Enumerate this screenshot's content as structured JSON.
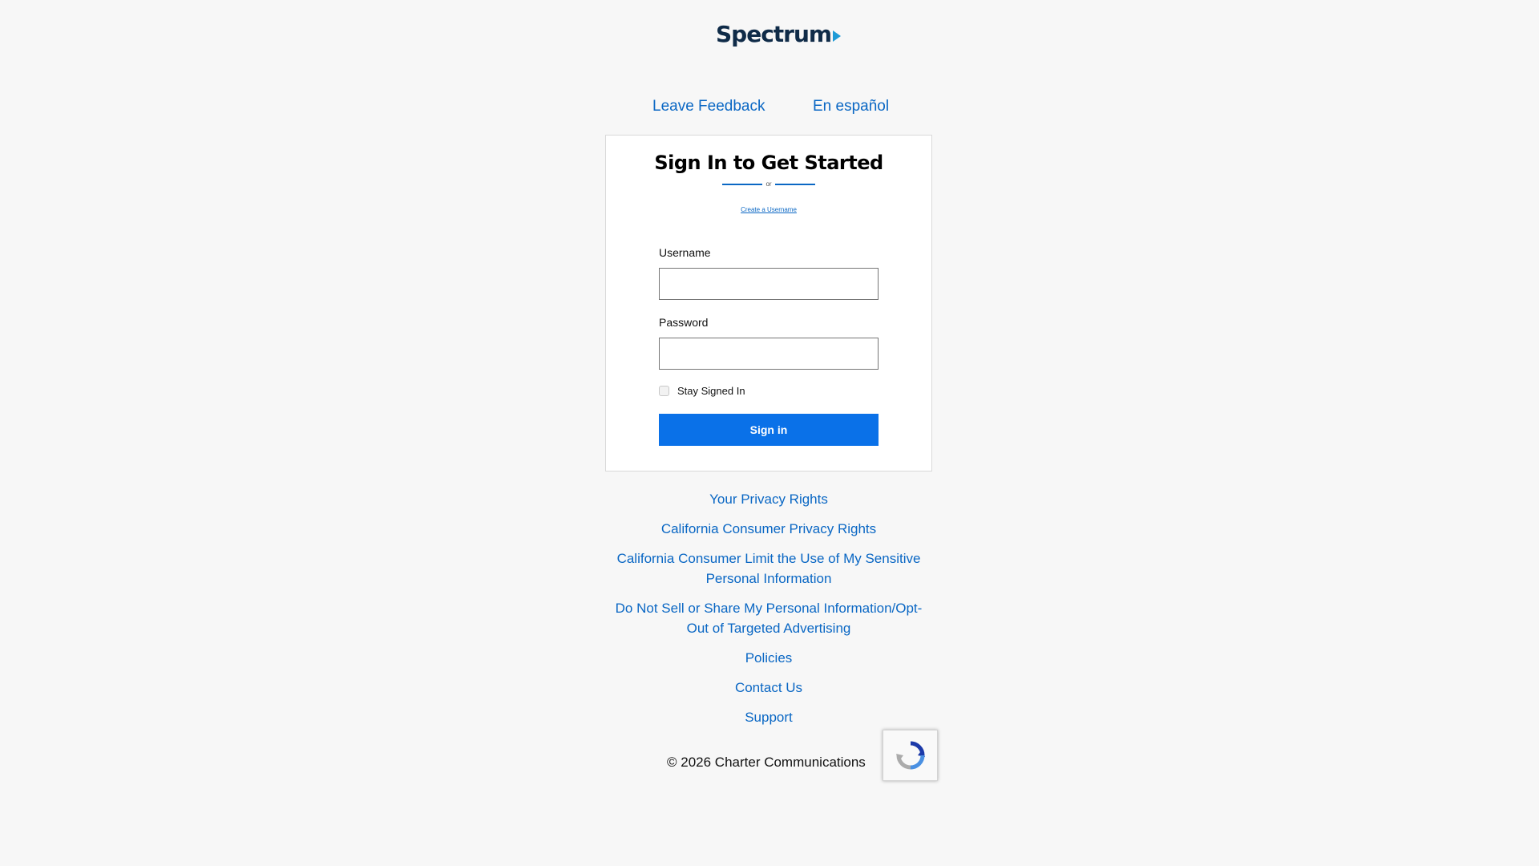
{
  "header": {
    "logo_text": "Spectrum"
  },
  "top_links": {
    "feedback": "Leave Feedback",
    "espanol": "En español"
  },
  "signin_card": {
    "title": "Sign In to Get Started",
    "divider_text": "or",
    "create_username": "Create a Username",
    "username_label": "Username",
    "username_value": "",
    "password_label": "Password",
    "password_value": "",
    "stay_signed_in_label": "Stay Signed In",
    "stay_signed_in_checked": false,
    "signin_button": "Sign in"
  },
  "footer": {
    "links": [
      "Your Privacy Rights",
      "California Consumer Privacy Rights",
      "California Consumer Limit the Use of My Sensitive Personal Information",
      "Do Not Sell or Share My Personal Information/Opt-Out of Targeted Advertising",
      "Policies",
      "Contact Us",
      "Support"
    ],
    "copyright": "© 2026 Charter Communications"
  },
  "colors": {
    "link": "#0a67c4",
    "button": "#0a71e8",
    "logo": "#0f2b48",
    "logo_accent": "#1e9bd7",
    "background": "#f7f7f7"
  },
  "icons": {
    "recaptcha": "recaptcha-icon"
  }
}
